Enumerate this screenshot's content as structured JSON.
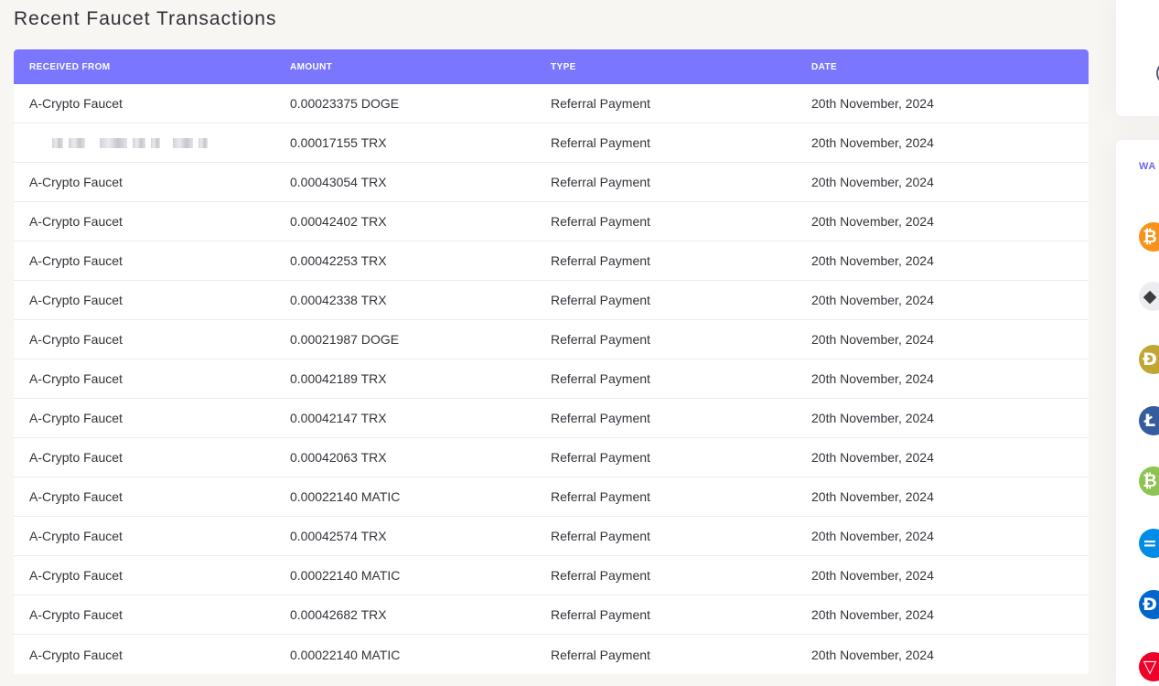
{
  "page": {
    "title": "Recent Faucet Transactions"
  },
  "table": {
    "headers": {
      "received_from": "RECEIVED FROM",
      "amount": "AMOUNT",
      "type": "TYPE",
      "date": "DATE"
    },
    "rows": [
      {
        "from": "A-Crypto Faucet",
        "amount": "0.00023375 DOGE",
        "type": "Referral Payment",
        "date": "20th November, 2024"
      },
      {
        "from": "",
        "amount": "0.00017155 TRX",
        "type": "Referral Payment",
        "date": "20th November, 2024",
        "from_redacted": true
      },
      {
        "from": "A-Crypto Faucet",
        "amount": "0.00043054 TRX",
        "type": "Referral Payment",
        "date": "20th November, 2024"
      },
      {
        "from": "A-Crypto Faucet",
        "amount": "0.00042402 TRX",
        "type": "Referral Payment",
        "date": "20th November, 2024"
      },
      {
        "from": "A-Crypto Faucet",
        "amount": "0.00042253 TRX",
        "type": "Referral Payment",
        "date": "20th November, 2024"
      },
      {
        "from": "A-Crypto Faucet",
        "amount": "0.00042338 TRX",
        "type": "Referral Payment",
        "date": "20th November, 2024"
      },
      {
        "from": "A-Crypto Faucet",
        "amount": "0.00021987 DOGE",
        "type": "Referral Payment",
        "date": "20th November, 2024"
      },
      {
        "from": "A-Crypto Faucet",
        "amount": "0.00042189 TRX",
        "type": "Referral Payment",
        "date": "20th November, 2024"
      },
      {
        "from": "A-Crypto Faucet",
        "amount": "0.00042147 TRX",
        "type": "Referral Payment",
        "date": "20th November, 2024"
      },
      {
        "from": "A-Crypto Faucet",
        "amount": "0.00042063 TRX",
        "type": "Referral Payment",
        "date": "20th November, 2024"
      },
      {
        "from": "A-Crypto Faucet",
        "amount": "0.00022140 MATIC",
        "type": "Referral Payment",
        "date": "20th November, 2024"
      },
      {
        "from": "A-Crypto Faucet",
        "amount": "0.00042574 TRX",
        "type": "Referral Payment",
        "date": "20th November, 2024"
      },
      {
        "from": "A-Crypto Faucet",
        "amount": "0.00022140 MATIC",
        "type": "Referral Payment",
        "date": "20th November, 2024"
      },
      {
        "from": "A-Crypto Faucet",
        "amount": "0.00042682 TRX",
        "type": "Referral Payment",
        "date": "20th November, 2024"
      },
      {
        "from": "A-Crypto Faucet",
        "amount": "0.00022140 MATIC",
        "type": "Referral Payment",
        "date": "20th November, 2024"
      }
    ]
  },
  "sidebar": {
    "wallet_label": "WA",
    "coins": [
      {
        "name": "bitcoin-icon",
        "glyph": "₿",
        "color": "#f7931a"
      },
      {
        "name": "ethereum-icon",
        "glyph": "◆",
        "color": "#ecedf0",
        "fg": "#3c3c3d"
      },
      {
        "name": "dogecoin-icon",
        "glyph": "Ð",
        "color": "#c2a633"
      },
      {
        "name": "litecoin-icon",
        "glyph": "Ł",
        "color": "#345d9d"
      },
      {
        "name": "bitcoin-cash-icon",
        "glyph": "₿",
        "color": "#8dc351"
      },
      {
        "name": "dash-icon",
        "glyph": "=",
        "color": "#008ce7"
      },
      {
        "name": "digibyte-icon",
        "glyph": "Ɖ",
        "color": "#0066cc"
      },
      {
        "name": "tron-icon",
        "glyph": "▽",
        "color": "#ef0027"
      }
    ]
  }
}
